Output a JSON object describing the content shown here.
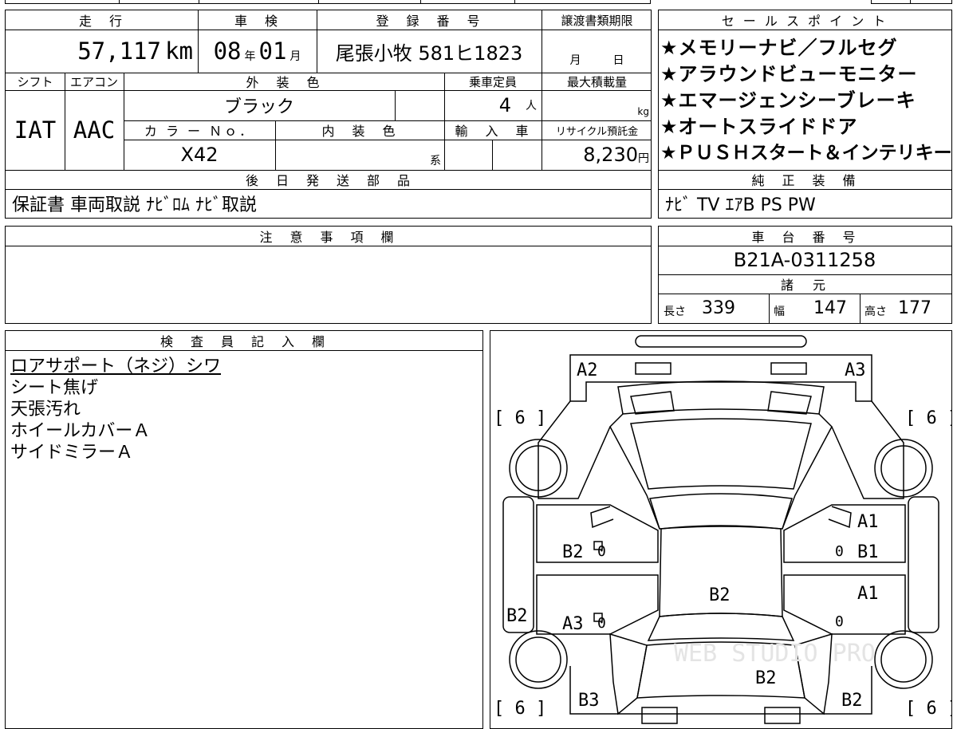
{
  "info": {
    "mileage_header": "走　行",
    "inspection_header": "車　検",
    "registration_header": "登　録　番　号",
    "transfer_header": "譲渡書類期限",
    "mileage_value": "57,117",
    "mileage_unit": "km",
    "inspection_year": "08",
    "year_unit": "年",
    "inspection_month": "01",
    "month_unit": "月",
    "registration_value": "尾張小牧 581ヒ1823",
    "transfer_month_unit": "月",
    "transfer_day_unit": "日",
    "shift_header": "シフト",
    "aircon_header": "エアコン",
    "exterior_header": "外　装　色",
    "capacity_header": "乗車定員",
    "load_header": "最大積載量",
    "shift_value": "IAT",
    "aircon_value": "AAC",
    "exterior_value": "ブラック",
    "capacity_value": "4",
    "capacity_unit": "人",
    "load_unit": "kg",
    "color_no_header": "カ ラ ー Ｎｏ．",
    "interior_header": "内　装　色",
    "import_header": "輸　入　車",
    "recycle_header": "リサイクル預託金",
    "color_no_value": "X42",
    "interior_unit": "系",
    "recycle_value": "8,230",
    "recycle_unit": "円",
    "parts_header": "後　日　発　送　部　品",
    "parts_value": "保証書 車両取説 ﾅﾋﾞﾛﾑ ﾅﾋﾞ取説"
  },
  "sales": {
    "header": "セ ー ル ス ポ イ ン ト",
    "points": [
      "★メモリーナビ／フルセグ",
      "★アラウンドビューモニター",
      "★エマージェンシーブレーキ",
      "★オートスライドドア",
      "★ＰＵＳＨスタート＆インテリキー"
    ],
    "equipment_header": "純　正　装　備",
    "equipment_value": "ﾅﾋﾞ TV ｴｱB PS PW"
  },
  "notes": {
    "header": "注　意　事　項　欄"
  },
  "chassis": {
    "header": "車　台　番　号",
    "value": "B21A-0311258",
    "specs_header": "諸　元",
    "length_label": "長さ",
    "length_value": "339",
    "width_label": "幅",
    "width_value": "147",
    "height_label": "高さ",
    "height_value": "177"
  },
  "inspector": {
    "header": "検　査　員　記　入　欄",
    "lines": [
      "ロアサポート（ネジ）シワ",
      "シート焦げ",
      "天張汚れ",
      "ホイールカバーＡ",
      "サイドミラーＡ"
    ]
  },
  "diagram": {
    "marks": {
      "front_left": "A2",
      "front_right": "A3",
      "tire_fl": "[ 6 ]",
      "tire_fr": "[ 6 ]",
      "tire_rl": "[ 6 ]",
      "tire_rr": "[ 6 ]",
      "door_fl": "B2",
      "door_fl_zero": "0",
      "door_rl": "A3",
      "door_rl_zero": "0",
      "side_left": "B2",
      "roof": "B2",
      "door_fr_a": "A1",
      "door_fr_b": "B1",
      "door_fr_zero": "0",
      "door_rr": "A1",
      "door_rr_zero": "0",
      "rear_left": "B3",
      "rear_center": "B2",
      "rear_right": "B2"
    },
    "watermark": "WEB STUDIO PRO"
  }
}
